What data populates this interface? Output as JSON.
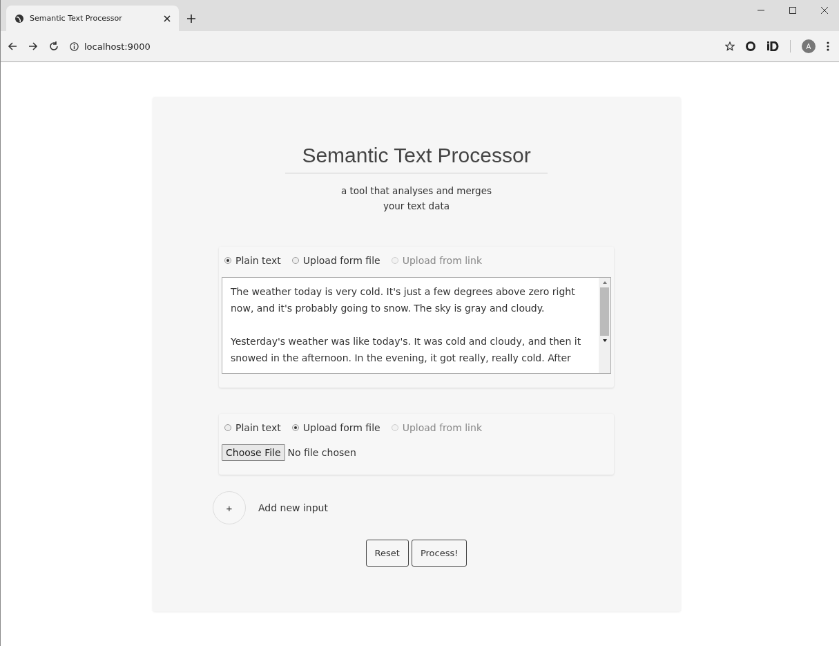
{
  "browser": {
    "tab_title": "Semantic Text Processor",
    "url": "localhost:9000",
    "profile_initial": "A"
  },
  "page": {
    "title": "Semantic Text Processor",
    "subtitle_lines": [
      "a tool that analyses and merges",
      "your text data"
    ],
    "inputs": [
      {
        "kind": "text",
        "options": [
          {
            "label": "Plain text",
            "selected": true,
            "disabled": false
          },
          {
            "label": "Upload form file",
            "selected": false,
            "disabled": false
          },
          {
            "label": "Upload from link",
            "selected": false,
            "disabled": true
          }
        ],
        "paragraphs": [
          [
            "The weather today is very cold. It's just a few degrees above zero right",
            "now, and it's probably going to snow. The sky is gray and cloudy."
          ],
          [
            "Yesterday's weather was like today's. It was cold and cloudy, and then it",
            "snowed in the afternoon. In the evening, it got really, really cold. After"
          ]
        ]
      },
      {
        "kind": "file",
        "options": [
          {
            "label": "Plain text",
            "selected": false,
            "disabled": false
          },
          {
            "label": "Upload form file",
            "selected": true,
            "disabled": false
          },
          {
            "label": "Upload from link",
            "selected": false,
            "disabled": true
          }
        ],
        "file_button": "Choose File",
        "file_status": "No file chosen"
      }
    ],
    "add_button": "+",
    "add_label": "Add new input",
    "buttons": [
      "Reset",
      "Process!"
    ]
  }
}
